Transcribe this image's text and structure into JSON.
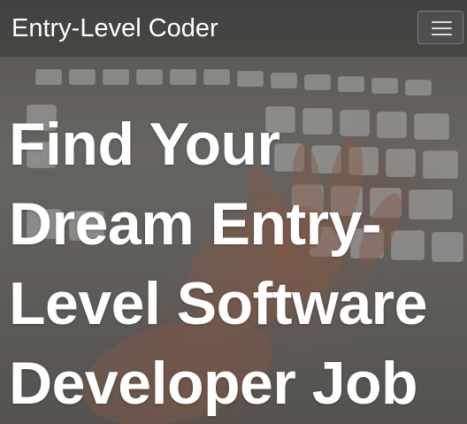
{
  "navbar": {
    "brand": "Entry-Level Coder",
    "toggle_icon": "hamburger-menu-icon"
  },
  "hero": {
    "headline_lines": [
      "Find Your",
      "Dream Entry-",
      "Level Software",
      "Developer Job"
    ],
    "background": "keyboard-typing-photo"
  }
}
